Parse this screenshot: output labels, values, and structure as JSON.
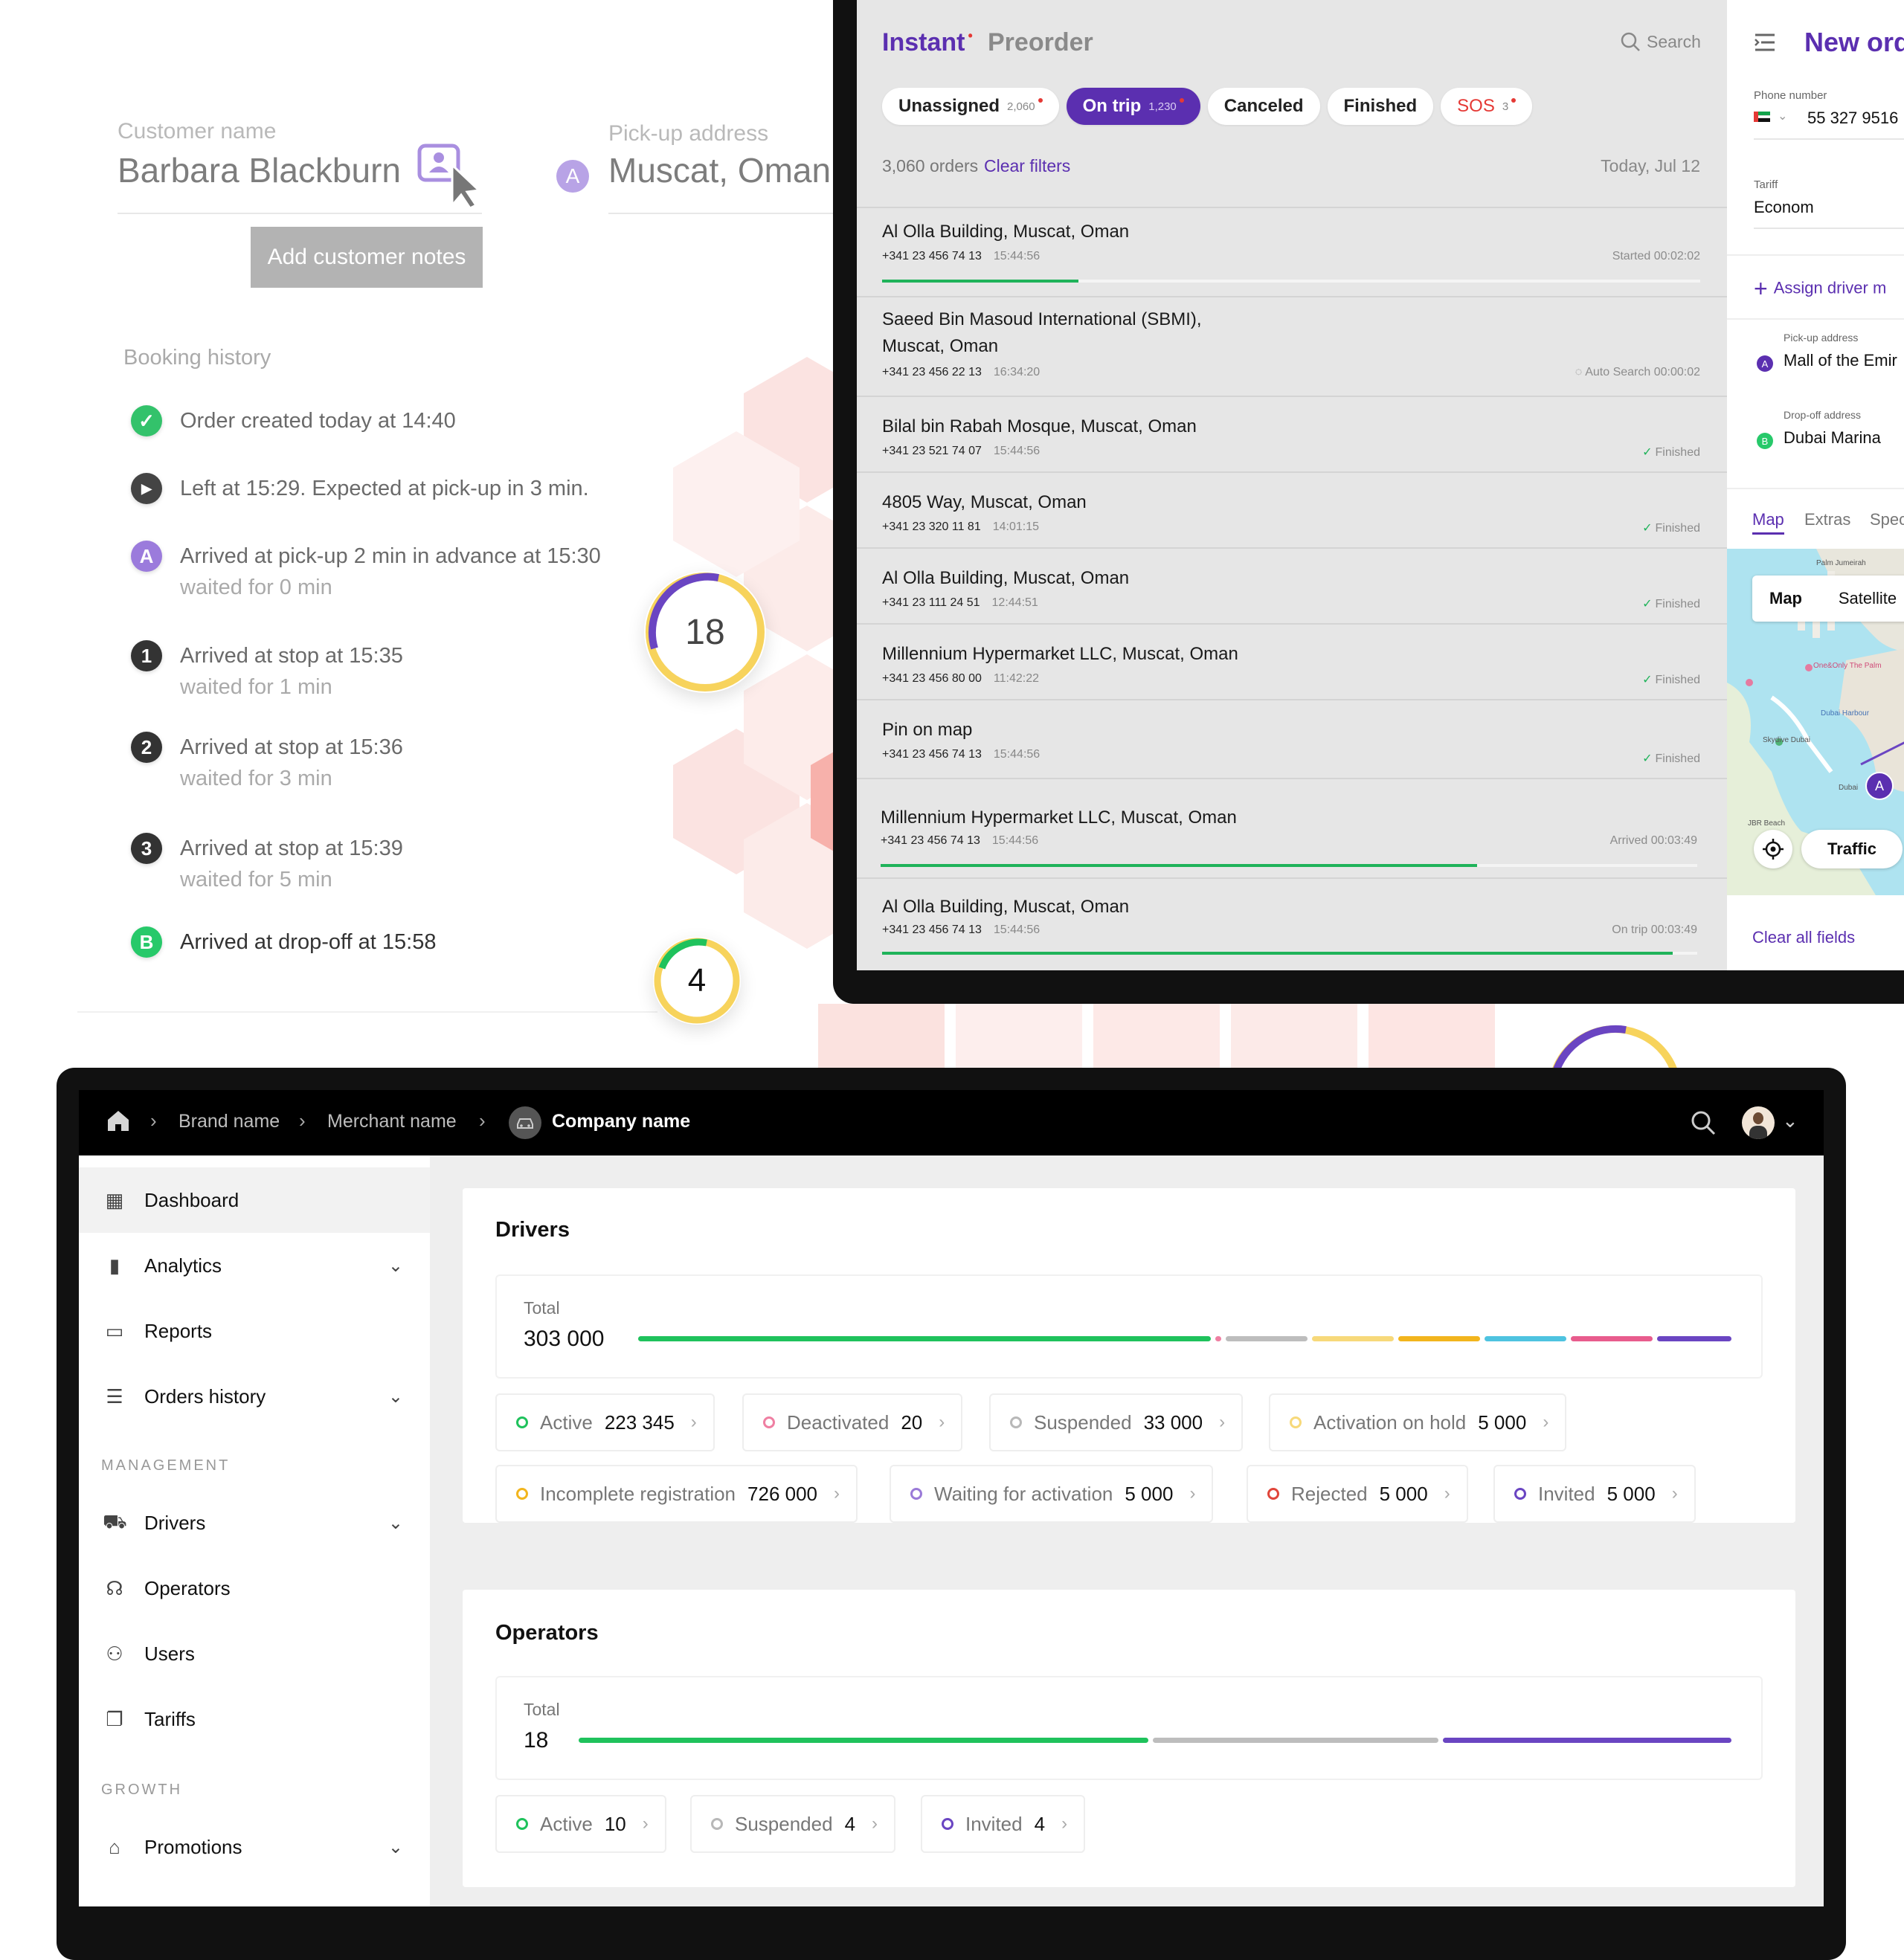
{
  "customer": {
    "name_label": "Customer name",
    "name_value": "Barbara Blackburn",
    "pickup_label": "Pick-up address",
    "pickup_marker": "A",
    "pickup_value": "Muscat, Oman",
    "notes_button": "Add customer notes"
  },
  "booking_history": {
    "title": "Booking history",
    "items": [
      {
        "marker": "",
        "text": "Order created today at 14:40",
        "sub": ""
      },
      {
        "marker": "",
        "text": "Left at 15:29. Expected at pick-up in 3 min.",
        "sub": ""
      },
      {
        "marker": "A",
        "text": "Arrived at pick-up 2 min in advance at 15:30",
        "sub": "waited for 0 min"
      },
      {
        "marker": "1",
        "text": "Arrived at stop at 15:35",
        "sub": "waited for 1 min"
      },
      {
        "marker": "2",
        "text": "Arrived at stop at 15:36",
        "sub": "waited for 3 min"
      },
      {
        "marker": "3",
        "text": "Arrived at stop at 15:39",
        "sub": "waited for 5 min"
      },
      {
        "marker": "B",
        "text": "Arrived at drop-off at 15:58",
        "sub": ""
      }
    ]
  },
  "rings": [
    {
      "value": "18"
    },
    {
      "value": "4"
    }
  ],
  "orders_screen": {
    "tab_instant": "Instant",
    "tab_preorder": "Preorder",
    "search_label": "Search",
    "filters": [
      {
        "label": "Unassigned",
        "count": "2,060"
      },
      {
        "label": "On trip",
        "count": "1,230"
      },
      {
        "label": "Canceled",
        "count": ""
      },
      {
        "label": "Finished",
        "count": ""
      },
      {
        "label": "SOS",
        "count": "3"
      }
    ],
    "orders_count": "3,060 orders",
    "clear_filters": "Clear filters",
    "date": "Today, Jul 12",
    "orders": [
      {
        "title": "Al Olla Building, Muscat, Oman",
        "phone": "+341 23 456 74 13",
        "time": "15:44:56",
        "status": "Started 00:02:02",
        "progress": 0.24
      },
      {
        "title": "Saeed Bin Masoud International (SBMI),",
        "title2": "Muscat, Oman",
        "phone": "+341 23 456 22 13",
        "time": "16:34:20",
        "status": "Auto Search 00:00:02"
      },
      {
        "title": "Bilal bin Rabah Mosque, Muscat, Oman",
        "phone": "+341 23 521 74 07",
        "time": "15:44:56",
        "status": "Finished"
      },
      {
        "title": "4805 Way, Muscat, Oman",
        "phone": "+341 23 320 11 81",
        "time": "14:01:15",
        "status": "Finished"
      },
      {
        "title": "Al Olla Building, Muscat, Oman",
        "phone": "+341 23 111 24 51",
        "time": "12:44:51",
        "status": "Finished"
      },
      {
        "title": "Millennium Hypermarket LLC, Muscat, Oman",
        "phone": "+341 23 456 80 00",
        "time": "11:42:22",
        "status": "Finished"
      },
      {
        "title": "Pin on map",
        "phone": "+341 23 456 74 13",
        "time": "15:44:56",
        "status": "Finished"
      },
      {
        "title": "Millennium Hypermarket LLC, Muscat, Oman",
        "phone": "+341 23 456 74 13",
        "time": "15:44:56",
        "status": "Arrived 00:03:49",
        "progress": 0.73
      },
      {
        "title": "Al Olla Building, Muscat, Oman",
        "phone": "+341 23 456 74 13",
        "time": "15:44:56",
        "status": "On trip 00:03:49",
        "progress": 0.97
      }
    ]
  },
  "new_order": {
    "title": "New orde",
    "phone_label": "Phone number",
    "phone_value": "55 327 9516",
    "tariff_label": "Tariff",
    "tariff_value": "Econom",
    "assign_driver": "Assign driver m",
    "pickup_label": "Pick-up address",
    "pickup_value": "Mall of the Emir",
    "dropoff_label": "Drop-off address",
    "dropoff_value": "Dubai Marina",
    "tabs": [
      "Map",
      "Extras",
      "Spec"
    ],
    "map_btn": "Map",
    "satellite_btn": "Satellite",
    "traffic_btn": "Traffic",
    "map_labels": [
      "Palm Jumeirah",
      "One&Only The Palm",
      "Dubai Harbour",
      "Skydive Dubai",
      "JBR Beach",
      "Dubai"
    ],
    "clear_all": "Clear all fields"
  },
  "breadcrumb": {
    "brand": "Brand name",
    "merchant": "Merchant name",
    "company": "Company name"
  },
  "sidebar": {
    "items": [
      {
        "label": "Dashboard"
      },
      {
        "label": "Analytics"
      },
      {
        "label": "Reports"
      },
      {
        "label": "Orders history"
      }
    ],
    "management_label": "MANAGEMENT",
    "management": [
      {
        "label": "Drivers"
      },
      {
        "label": "Operators"
      },
      {
        "label": "Users"
      },
      {
        "label": "Tariffs"
      }
    ],
    "growth_label": "GROWTH",
    "growth": [
      {
        "label": "Promotions"
      }
    ]
  },
  "drivers": {
    "title": "Drivers",
    "total_label": "Total",
    "total_value": "303 000",
    "stats": [
      {
        "label": "Active",
        "value": "223 345",
        "color": "#1fc25c"
      },
      {
        "label": "Deactivated",
        "value": "20",
        "color": "#ef7fa2"
      },
      {
        "label": "Suspended",
        "value": "33 000",
        "color": "#b8b8b8"
      },
      {
        "label": "Activation on hold",
        "value": "5 000",
        "color": "#f7d97a"
      },
      {
        "label": "Incomplete registration",
        "value": "726 000",
        "color": "#f2b51d"
      },
      {
        "label": "Waiting for activation",
        "value": "5 000",
        "color": "#9a7ad8"
      },
      {
        "label": "Rejected",
        "value": "5 000",
        "color": "#e0453a"
      },
      {
        "label": "Invited",
        "value": "5 000",
        "color": "#6a45c2"
      }
    ]
  },
  "operators": {
    "title": "Operators",
    "total_label": "Total",
    "total_value": "18",
    "stats": [
      {
        "label": "Active",
        "value": "10",
        "color": "#1fc25c"
      },
      {
        "label": "Suspended",
        "value": "4",
        "color": "#b8b8b8"
      },
      {
        "label": "Invited",
        "value": "4",
        "color": "#6a45c2"
      }
    ]
  },
  "colors": {
    "accent": "#5b2fb0",
    "green": "#1fc25c",
    "purple": "#6a45c2",
    "yellow": "#f7d35c"
  }
}
